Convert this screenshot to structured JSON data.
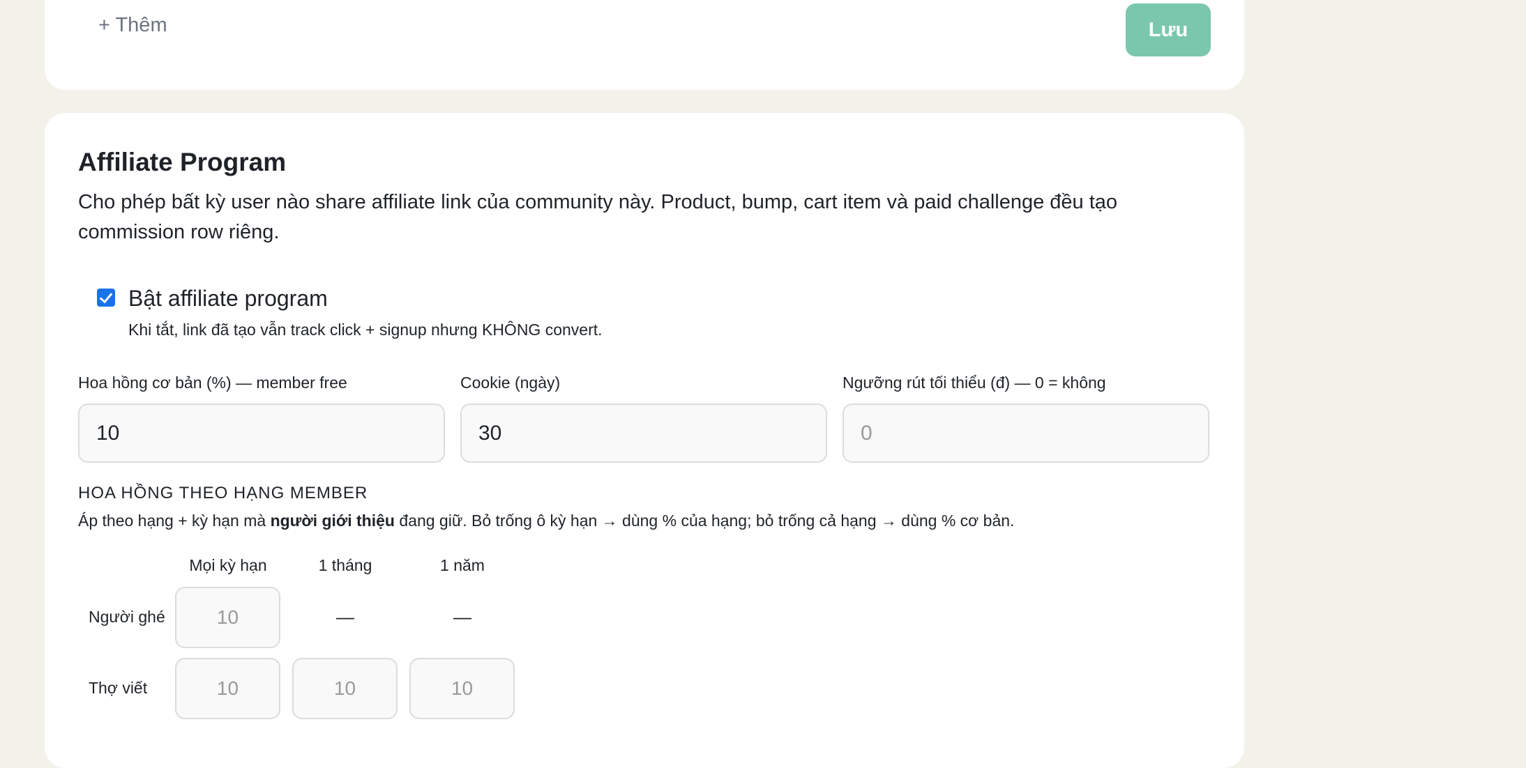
{
  "top_card": {
    "add_label": "+ Thêm",
    "save_label": "Lưu"
  },
  "affiliate": {
    "title": "Affiliate Program",
    "description": "Cho phép bất kỳ user nào share affiliate link của community này. Product, bump, cart item và paid challenge đều tạo commission row riêng.",
    "enable": {
      "checked": true,
      "label": "Bật affiliate program",
      "hint": "Khi tắt, link đã tạo vẫn track click + signup nhưng KHÔNG convert."
    },
    "fields": [
      {
        "label": "Hoa hồng cơ bản (%) — member free",
        "value": "10",
        "placeholder": ""
      },
      {
        "label": "Cookie (ngày)",
        "value": "30",
        "placeholder": ""
      },
      {
        "label": "Ngưỡng rút tối thiểu (đ) — 0 = không",
        "value": "",
        "placeholder": "0"
      }
    ],
    "tiers": {
      "title": "HOA HỒNG THEO HẠNG MEMBER",
      "desc_before": "Áp theo hạng + kỳ hạn mà ",
      "desc_bold": "người giới thiệu",
      "desc_after": " đang giữ. Bỏ trống ô kỳ hạn → dùng % của hạng; bỏ trống cả hạng → dùng % cơ bản.",
      "columns": [
        "Mọi kỳ hạn",
        "1 tháng",
        "1 năm"
      ],
      "rows": [
        {
          "label": "Người ghé",
          "cells": [
            {
              "placeholder": "10"
            },
            {
              "dash": "—"
            },
            {
              "dash": "—"
            }
          ]
        },
        {
          "label": "Thợ viết",
          "cells": [
            {
              "placeholder": "10"
            },
            {
              "placeholder": "10"
            },
            {
              "placeholder": "10"
            }
          ]
        }
      ]
    }
  }
}
